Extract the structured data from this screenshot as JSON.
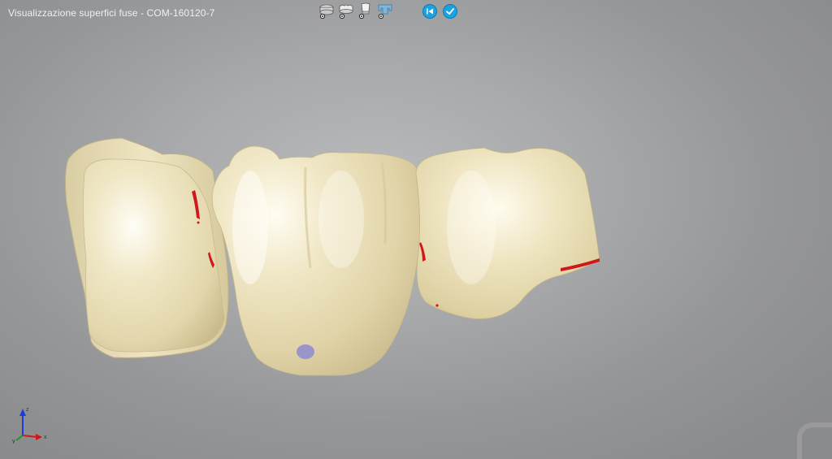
{
  "window": {
    "title": "Visualizzazione superfici fuse  - COM-160120-7"
  },
  "toolbar": {
    "tools": [
      {
        "icon": "crown-base-icon"
      },
      {
        "icon": "crown-top-icon"
      },
      {
        "icon": "tooth-profile-icon"
      },
      {
        "icon": "bridge-icon"
      }
    ],
    "nav": [
      {
        "icon": "back-to-start-icon"
      },
      {
        "icon": "confirm-check-icon"
      }
    ]
  },
  "viewer": {
    "object": "fused dental crown bridge (3 units)",
    "material_color": "#ece2bd",
    "contact_highlight_color": "#d0181a",
    "marker_color": "#9a95c8"
  },
  "axes_indicator": {
    "labels": [
      "z",
      "y",
      "x"
    ]
  }
}
